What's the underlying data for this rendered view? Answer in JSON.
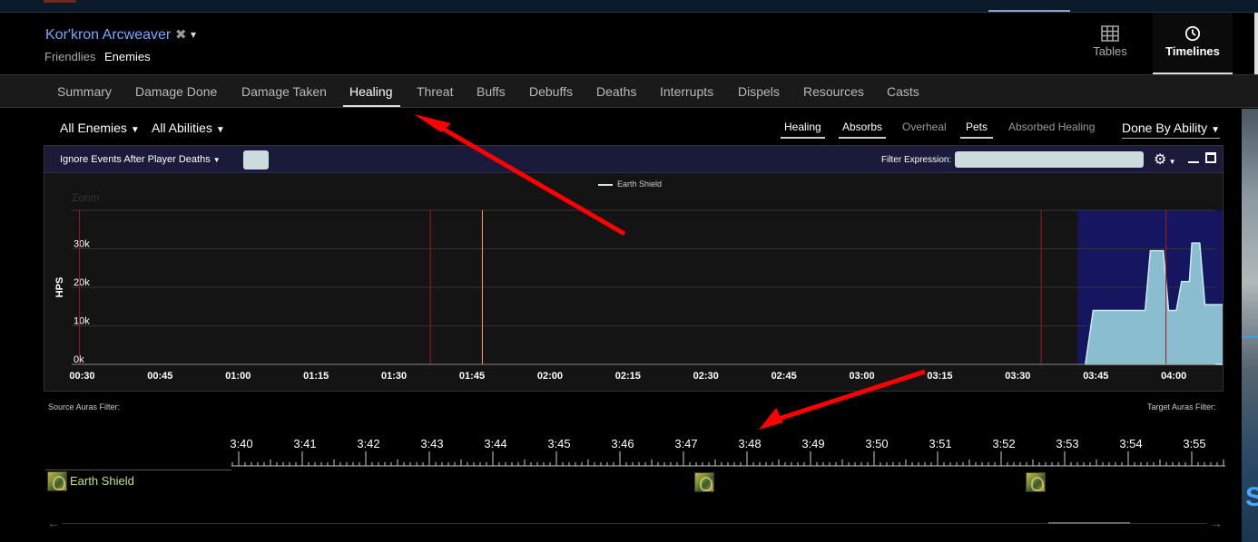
{
  "header": {
    "character_name": "Kor'kron Arcweaver",
    "remove_glyph": "✖",
    "caret_glyph": "▾",
    "friendlies_label": "Friendlies",
    "enemies_label": "Enemies",
    "view_tables_label": "Tables",
    "view_timelines_label": "Timelines",
    "active_view": "Timelines"
  },
  "nav": {
    "tabs": [
      "Summary",
      "Damage Done",
      "Damage Taken",
      "Healing",
      "Threat",
      "Buffs",
      "Debuffs",
      "Deaths",
      "Interrupts",
      "Dispels",
      "Resources",
      "Casts"
    ],
    "active": "Healing"
  },
  "filters": {
    "enemies_dropdown": "All Enemies",
    "abilities_dropdown": "All Abilities",
    "toggles": [
      {
        "label": "Healing",
        "on": true
      },
      {
        "label": "Absorbs",
        "on": true
      },
      {
        "label": "Overheal",
        "on": false
      },
      {
        "label": "Pets",
        "on": true
      },
      {
        "label": "Absorbed Healing",
        "on": false
      }
    ],
    "grouping_dropdown": "Done By Ability"
  },
  "panel": {
    "ignore_label": "Ignore Events After Player Deaths",
    "filter_expression_label": "Filter Expression:",
    "filter_expression_value": ""
  },
  "chart_data": {
    "type": "area",
    "title": "",
    "zoom_label": "Zoom",
    "ylabel": "HPS",
    "xlabel": "",
    "legend": "Earth Shield",
    "legend_position": "top-center",
    "x_ticks": [
      "00:30",
      "00:45",
      "01:00",
      "01:15",
      "01:30",
      "01:45",
      "02:00",
      "02:15",
      "02:30",
      "02:45",
      "03:00",
      "03:15",
      "03:30",
      "03:45",
      "04:00"
    ],
    "y_ticks": [
      "0k",
      "10k",
      "20k",
      "30k"
    ],
    "xlim_seconds": [
      28,
      248
    ],
    "ylim": [
      0,
      40000
    ],
    "grid": true,
    "series": [
      {
        "name": "Earth Shield",
        "x_seconds": [
          223.0,
          224.5,
          234.5,
          235.5,
          238.0,
          239.0,
          240.5,
          241.5,
          243.0,
          243.5,
          245.0,
          246.0,
          251.0,
          256.5
        ],
        "values": [
          0,
          14000,
          14000,
          29500,
          29500,
          14000,
          14000,
          21500,
          21500,
          31500,
          31500,
          15500,
          15500,
          0
        ]
      }
    ],
    "markers": [
      {
        "x_seconds": 29.5,
        "kind": "death"
      },
      {
        "x_seconds": 97.0,
        "kind": "death"
      },
      {
        "x_seconds": 107.0,
        "kind": "event"
      },
      {
        "x_seconds": 214.5,
        "kind": "death"
      },
      {
        "x_seconds": 238.5,
        "kind": "death"
      },
      {
        "x_seconds": 250.5,
        "kind": "death"
      },
      {
        "x_seconds": 251.5,
        "kind": "death"
      },
      {
        "x_seconds": 252.5,
        "kind": "death"
      },
      {
        "x_seconds": 255.0,
        "kind": "death"
      }
    ],
    "selection_seconds": [
      221.5,
      253.0
    ],
    "colors": {
      "area_fill": "#8bbdd0",
      "area_line": "#c9edf2",
      "death_marker": "#9b1d1d",
      "event_marker": "#ff9a40",
      "selection": "#151560"
    }
  },
  "timeline": {
    "source_auras_label": "Source Auras Filter:",
    "target_auras_label": "Target Auras Filter:",
    "tick_labels": [
      "3:40",
      "3:41",
      "3:42",
      "3:43",
      "3:44",
      "3:45",
      "3:46",
      "3:47",
      "3:48",
      "3:49",
      "3:50",
      "3:51",
      "3:52",
      "3:53",
      "3:54",
      "3:55"
    ],
    "aura": {
      "name": "Earth Shield",
      "icon": "earth-shield-icon",
      "applications_seconds": [
        227.0,
        232.2
      ]
    }
  }
}
